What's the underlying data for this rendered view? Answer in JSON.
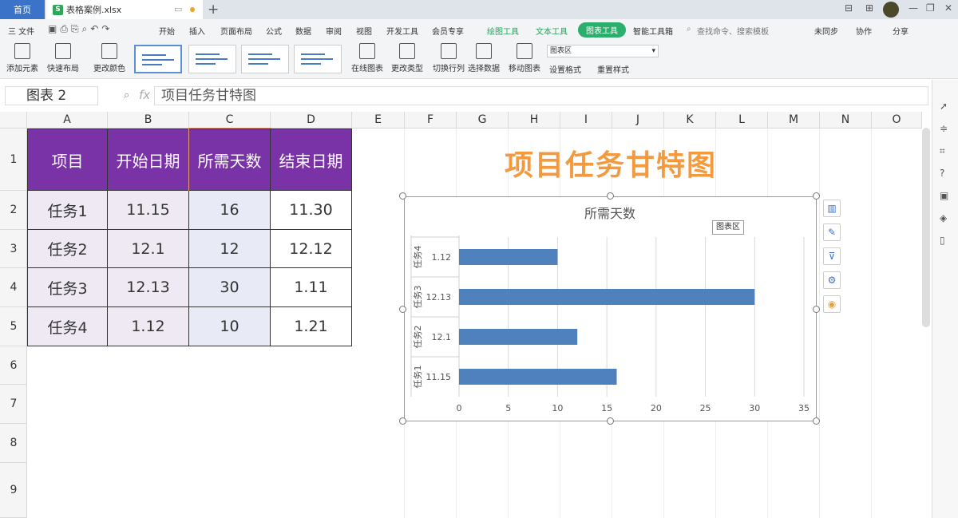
{
  "titlebar": {
    "home_tab": "首页",
    "file_tab": "表格案例.xlsx",
    "new_tab": "+"
  },
  "menubar": {
    "file": "三 文件",
    "items": [
      "开始",
      "插入",
      "页面布局",
      "公式",
      "数据",
      "审阅",
      "视图",
      "开发工具",
      "会员专享"
    ],
    "context_tabs": [
      "绘图工具",
      "文本工具",
      "图表工具",
      "智能工具箱"
    ],
    "search_placeholder": "查找命令、搜索模板",
    "right_items": [
      "未同步",
      "协作",
      "分享"
    ]
  },
  "toolbar": {
    "add_element": "添加元素",
    "quick_layout": "快速布局",
    "change_color": "更改颜色",
    "online_chart": "在线图表",
    "change_type": "更改类型",
    "switch_row_col": "切换行列",
    "select_data": "选择数据",
    "move_chart": "移动图表",
    "chart_area_select": "图表区",
    "set_format": "设置格式",
    "reset_style": "重置样式"
  },
  "formula": {
    "name_box": "图表 2",
    "fx": "fx",
    "content": "项目任务甘特图"
  },
  "columns": [
    "A",
    "B",
    "C",
    "D",
    "E",
    "F",
    "G",
    "H",
    "I",
    "J",
    "K",
    "L",
    "M",
    "N",
    "O"
  ],
  "rows": [
    "1",
    "2",
    "3",
    "4",
    "5",
    "6",
    "7",
    "8",
    "9"
  ],
  "table": {
    "headers": [
      "项目",
      "开始日期",
      "所需天数",
      "结束日期"
    ],
    "rows": [
      [
        "任务1",
        "11.15",
        "16",
        "11.30"
      ],
      [
        "任务2",
        "12.1",
        "12",
        "12.12"
      ],
      [
        "任务3",
        "12.13",
        "30",
        "1.11"
      ],
      [
        "任务4",
        "1.12",
        "10",
        "1.21"
      ]
    ]
  },
  "sheet_title": "项目任务甘特图",
  "chart_tooltip": "图表区",
  "chart_data": {
    "type": "bar",
    "orientation": "horizontal",
    "title": "所需天数",
    "categories": [
      {
        "group": "任务1",
        "label": "11.15"
      },
      {
        "group": "任务2",
        "label": "12.1"
      },
      {
        "group": "任务3",
        "label": "12.13"
      },
      {
        "group": "任务4",
        "label": "1.12"
      }
    ],
    "values": [
      16,
      12,
      30,
      10
    ],
    "xlim": [
      0,
      35
    ],
    "xticks": [
      0,
      5,
      10,
      15,
      20,
      25,
      30,
      35
    ],
    "grid": true,
    "bar_color": "#4f81bd"
  },
  "colors": {
    "header_bg": "#7a32a7",
    "title_orange": "#f39a3f",
    "accent_green": "#2cae6c",
    "home_blue": "#3b73c8"
  }
}
